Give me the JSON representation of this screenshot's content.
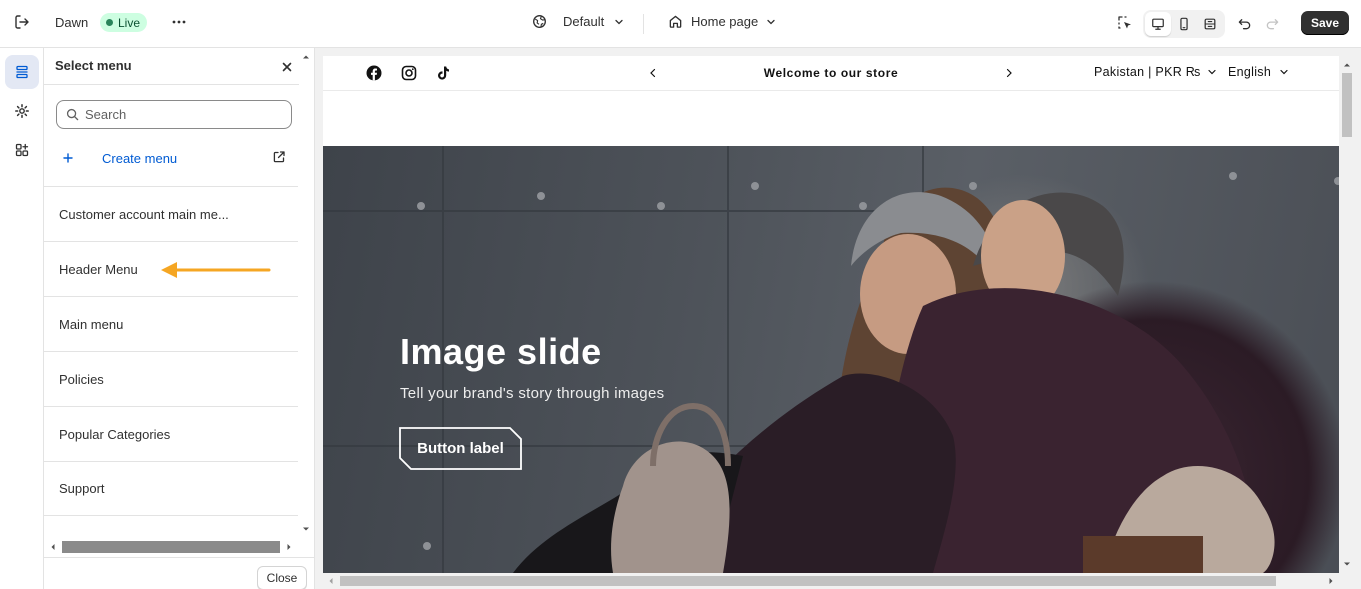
{
  "topbar": {
    "theme_name": "Dawn",
    "status": "Live",
    "template": "Default",
    "page": "Home page",
    "save_label": "Save"
  },
  "panel": {
    "title": "Select menu",
    "search_placeholder": "Search",
    "create_label": "Create menu",
    "menus": [
      {
        "label": "Customer account main me..."
      },
      {
        "label": "Header Menu"
      },
      {
        "label": "Main menu"
      },
      {
        "label": "Policies"
      },
      {
        "label": "Popular Categories"
      },
      {
        "label": "Support"
      }
    ],
    "close_label": "Close"
  },
  "preview": {
    "announcement": "Welcome to our store",
    "country": "Pakistan | PKR ₨",
    "language": "English",
    "hero": {
      "heading": "Image slide",
      "subheading": "Tell your brand's story through images",
      "button_label": "Button label"
    }
  },
  "colors": {
    "accent": "#005bd3",
    "live_bg": "#cdfee1",
    "live_dot": "#29845a",
    "annotation_arrow": "#f5a623",
    "save_bg": "#303030"
  }
}
